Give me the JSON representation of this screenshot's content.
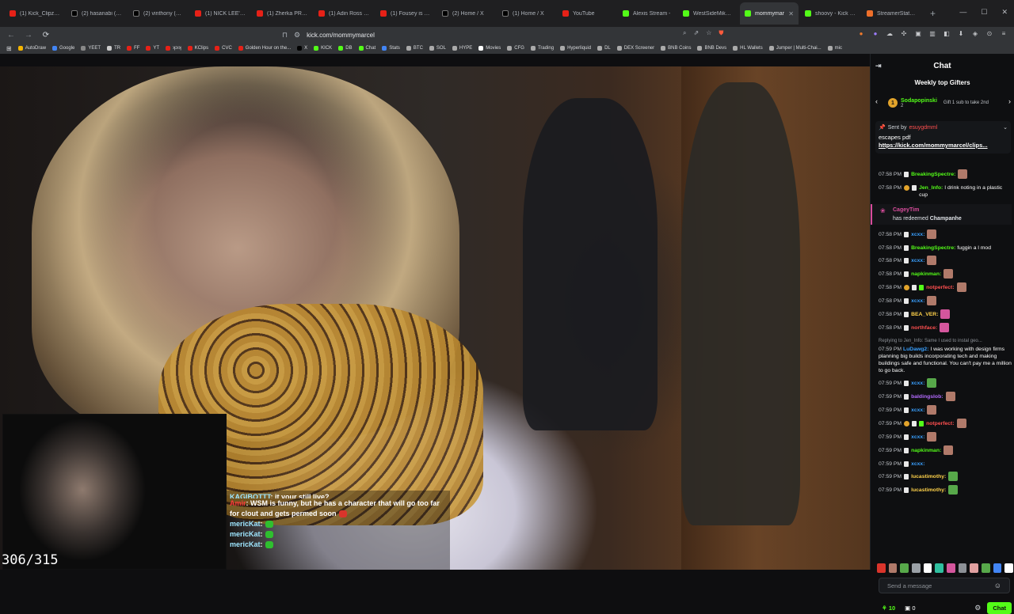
{
  "browser": {
    "tabs": [
      {
        "favicon": "yt",
        "title": "(1) Kick_Clipz - YouT"
      },
      {
        "favicon": "x",
        "title": "(2) hasanabi (@hasan"
      },
      {
        "favicon": "x",
        "title": "(2) vinthony (@vinth"
      },
      {
        "favicon": "yt",
        "title": "(1) NICK LEE'S EVEN"
      },
      {
        "favicon": "yt",
        "title": "(1) Zherka PRESSES"
      },
      {
        "favicon": "yt",
        "title": "(1) Adin Ross Reacts"
      },
      {
        "favicon": "yt",
        "title": "(1) Fousey is Back |"
      },
      {
        "favicon": "x",
        "title": "(2) Home / X"
      },
      {
        "favicon": "x",
        "title": "(1) Home / X"
      },
      {
        "favicon": "yt",
        "title": "YouTube"
      },
      {
        "favicon": "kick",
        "title": "Alexis Stream -"
      },
      {
        "favicon": "kick",
        "title": "WestSideMike Strea"
      },
      {
        "favicon": "kick",
        "title": "mommymar",
        "active": true
      },
      {
        "favicon": "kick",
        "title": "shoovy - Kick Stats"
      },
      {
        "favicon": "ss",
        "title": "StreamerStats - shoo"
      }
    ],
    "url": "kick.com/mommymarcel",
    "bookmarks": [
      {
        "label": "AutoDraw",
        "color": "#f4b400"
      },
      {
        "label": "Google",
        "color": "#4285f4"
      },
      {
        "label": "YEET",
        "color": "#888888"
      },
      {
        "label": "TR",
        "color": "#cccccc"
      },
      {
        "label": "FF",
        "color": "#e62117"
      },
      {
        "label": "YT",
        "color": "#e62117"
      },
      {
        "label": "ʞɔıʞ",
        "color": "#e62117"
      },
      {
        "label": "KClips",
        "color": "#e62117"
      },
      {
        "label": "CVC",
        "color": "#e62117"
      },
      {
        "label": "Golden Hour on the...",
        "color": "#e62117"
      },
      {
        "label": "X",
        "color": "#000000"
      },
      {
        "label": "KICK",
        "color": "#53fc18"
      },
      {
        "label": "DB",
        "color": "#53fc18"
      },
      {
        "label": "Chat",
        "color": "#53fc18"
      },
      {
        "label": "Stats",
        "color": "#4285f4"
      },
      {
        "label": "BTC",
        "color": "#aaaaaa"
      },
      {
        "label": "SOL",
        "color": "#aaaaaa"
      },
      {
        "label": "HYPE",
        "color": "#aaaaaa"
      },
      {
        "label": "Movies",
        "color": "#ffffff"
      },
      {
        "label": "CFG",
        "color": "#aaaaaa"
      },
      {
        "label": "Trading",
        "color": "#aaaaaa"
      },
      {
        "label": "Hyperliquid",
        "color": "#aaaaaa"
      },
      {
        "label": "DL",
        "color": "#aaaaaa"
      },
      {
        "label": "DEX Screener",
        "color": "#aaaaaa"
      },
      {
        "label": "BNB Coins",
        "color": "#aaaaaa"
      },
      {
        "label": "BNB Devs",
        "color": "#aaaaaa"
      },
      {
        "label": "HL Wallets",
        "color": "#aaaaaa"
      },
      {
        "label": "Jumper | Multi-Chai...",
        "color": "#aaaaaa"
      },
      {
        "label": "mic",
        "color": "#aaaaaa"
      }
    ]
  },
  "stream": {
    "counter": "306/315",
    "overlay_chat": [
      {
        "user": "KAGIBOTTT",
        "text": ": it your still live?",
        "user_color": "cyan",
        "emote": false,
        "cut": true
      },
      {
        "user": "Amir",
        "text": ": WSM is funny, but he has a character that will go too far",
        "user_color": "red",
        "emote": false
      },
      {
        "user": "",
        "text": "for clout and gets permed soon",
        "user_color": "cyan",
        "emote": "red"
      },
      {
        "user": "mericKat",
        "text": ":",
        "user_color": "cyan",
        "emote": "green"
      },
      {
        "user": "mericKat",
        "text": ":",
        "user_color": "cyan",
        "emote": "green"
      },
      {
        "user": "mericKat",
        "text": ":",
        "user_color": "cyan",
        "emote": "green"
      }
    ]
  },
  "chat": {
    "title": "Chat",
    "gifters_title": "Weekly top Gifters",
    "top_gifter": {
      "rank": "1",
      "name": "Sodapopinski",
      "count": "2",
      "note": "Gift 1 sub to take 2nd"
    },
    "pinned": {
      "sent_by_label": "Sent by",
      "sent_by_user": "esuygdmml",
      "message": "escapes pdf",
      "link": "https://kick.com/mommymarcel/clips..."
    },
    "redeem": {
      "user": "CageyTim",
      "text": "has redeemed",
      "reward": "Champanhe"
    },
    "reply_note": "Replying to Jen_Info: Same I used to instal geo...",
    "messages_before": [
      {
        "time": "07:58 PM",
        "badges": [
          "gray"
        ],
        "user": "BreakingSpectre:",
        "color": "#53fc18",
        "text": "",
        "emote": "brown"
      },
      {
        "time": "07:58 PM",
        "badges": [
          "gold",
          "gray"
        ],
        "user": "Jen_Info:",
        "color": "#53fc18",
        "text": "I drink noting in a plastic cup",
        "emote": ""
      }
    ],
    "messages_after": [
      {
        "time": "07:58 PM",
        "badges": [
          "gray"
        ],
        "user": "xcxx:",
        "color": "#39a0ff",
        "text": "",
        "emote": "brown"
      },
      {
        "time": "07:58 PM",
        "badges": [
          "gray"
        ],
        "user": "BreakingSpectre:",
        "color": "#53fc18",
        "text": "fuggin a l mod",
        "emote": ""
      },
      {
        "time": "07:58 PM",
        "badges": [
          "gray"
        ],
        "user": "xcxx:",
        "color": "#39a0ff",
        "text": "",
        "emote": "brown"
      },
      {
        "time": "07:58 PM",
        "badges": [
          "gray"
        ],
        "user": "napkinman:",
        "color": "#53fc18",
        "text": "",
        "emote": "brown"
      },
      {
        "time": "07:58 PM",
        "badges": [
          "gold",
          "gray",
          "green"
        ],
        "user": "notperfect:",
        "color": "#ff4f4f",
        "text": "",
        "emote": "brown"
      },
      {
        "time": "07:58 PM",
        "badges": [
          "gray"
        ],
        "user": "xcxx:",
        "color": "#39a0ff",
        "text": "",
        "emote": "brown"
      },
      {
        "time": "07:58 PM",
        "badges": [
          "gray"
        ],
        "user": "BEA_VER:",
        "color": "#ffd24a",
        "text": "",
        "emote": "pink"
      },
      {
        "time": "07:58 PM",
        "badges": [
          "gray"
        ],
        "user": "northface:",
        "color": "#ff4f4f",
        "text": "",
        "emote": "pink"
      }
    ],
    "reply_message": {
      "time": "07:59 PM",
      "user": "LuDawg2:",
      "color": "#39a0ff",
      "text": "I was working with design firms planning big builds incorporating tech and making buildings safe and functional. You can't pay me a million to go back."
    },
    "messages_end": [
      {
        "time": "07:59 PM",
        "badges": [
          "gray"
        ],
        "user": "xcxx:",
        "color": "#39a0ff",
        "text": "",
        "emote": "green"
      },
      {
        "time": "07:59 PM",
        "badges": [
          "gray"
        ],
        "user": "baldingslob:",
        "color": "#b46bff",
        "text": "",
        "emote": "brown"
      },
      {
        "time": "07:59 PM",
        "badges": [
          "gray"
        ],
        "user": "xcxx:",
        "color": "#39a0ff",
        "text": "",
        "emote": "brown"
      },
      {
        "time": "07:59 PM",
        "badges": [
          "gold",
          "gray",
          "green"
        ],
        "user": "notperfect:",
        "color": "#ff4f4f",
        "text": "",
        "emote": "brown"
      },
      {
        "time": "07:59 PM",
        "badges": [
          "gray"
        ],
        "user": "xcxx:",
        "color": "#39a0ff",
        "text": "",
        "emote": "brown"
      },
      {
        "time": "07:59 PM",
        "badges": [
          "gray"
        ],
        "user": "napkinman:",
        "color": "#53fc18",
        "text": "",
        "emote": "brown"
      },
      {
        "time": "07:59 PM",
        "badges": [
          "gray"
        ],
        "user": "xcxx:",
        "color": "#39a0ff",
        "text": "",
        "emote": ""
      },
      {
        "time": "07:59 PM",
        "badges": [
          "gray"
        ],
        "user": "lucastimothy:",
        "color": "#ffd24a",
        "text": "",
        "emote": "green"
      },
      {
        "time": "07:59 PM",
        "badges": [
          "gray"
        ],
        "user": "lucastimothy:",
        "color": "#ffd24a",
        "text": "",
        "emote": "green"
      }
    ],
    "emote_bar_colors": [
      "#d9342b",
      "#b07a6a",
      "#57a84a",
      "#9aa0a6",
      "#ffffff",
      "#2fbf9f",
      "#d4569d",
      "#8c9096",
      "#e0a0a0",
      "#57a84a",
      "#4285f4",
      "#ffffff"
    ],
    "input_placeholder": "Send a message",
    "points": "10",
    "subs": "0",
    "chat_button": "Chat"
  }
}
